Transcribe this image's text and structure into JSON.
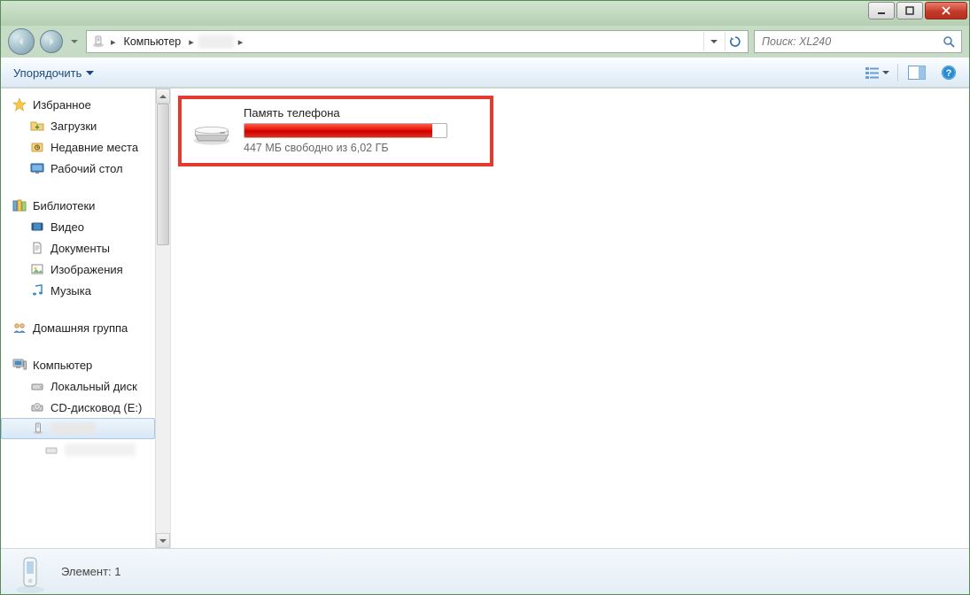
{
  "breadcrumb": {
    "root": "Компьютер"
  },
  "search": {
    "placeholder": "Поиск: XL240"
  },
  "toolbar": {
    "organize": "Упорядочить"
  },
  "sidebar": {
    "favorites": {
      "label": "Избранное"
    },
    "downloads": {
      "label": "Загрузки"
    },
    "recent": {
      "label": "Недавние места"
    },
    "desktop": {
      "label": "Рабочий стол"
    },
    "libraries": {
      "label": "Библиотеки"
    },
    "video": {
      "label": "Видео"
    },
    "documents": {
      "label": "Документы"
    },
    "images": {
      "label": "Изображения"
    },
    "music": {
      "label": "Музыка"
    },
    "homegroup": {
      "label": "Домашняя группа"
    },
    "computer": {
      "label": "Компьютер"
    },
    "localdisk": {
      "label": "Локальный диск"
    },
    "cddrive": {
      "label": "CD-дисковод (E:)"
    }
  },
  "drive": {
    "title": "Память телефона",
    "free_text": "447 МБ свободно из 6,02 ГБ",
    "fill_percent": 93
  },
  "status": {
    "text": "Элемент: 1"
  }
}
